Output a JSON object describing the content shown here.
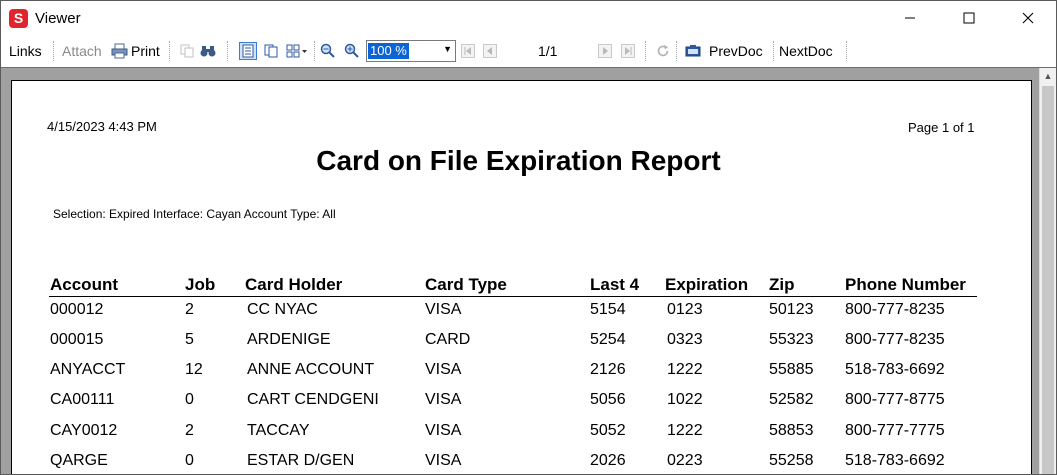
{
  "window": {
    "title": "Viewer",
    "app_icon_letter": "S"
  },
  "toolbar": {
    "links_label": "Links",
    "attach_label": "Attach",
    "print_label": "Print",
    "zoom_value": "100 %",
    "page_indicator": "1/1",
    "prevdoc_label": "PrevDoc",
    "nextdoc_label": "NextDoc"
  },
  "report": {
    "printed_at": "4/15/2023 4:43 PM",
    "page_number": "Page 1 of 1",
    "title": "Card on File Expiration Report",
    "selection": "Selection: Expired Interface: Cayan  Account Type: All",
    "columns": [
      "Account",
      "Job",
      "Card Holder",
      "Card Type",
      "Last 4",
      "Expiration",
      "Zip",
      "Phone Number"
    ],
    "rows": [
      [
        "000012",
        "2",
        "CC NYAC",
        "VISA",
        "5154",
        "0123",
        "50123",
        "800-777-8235"
      ],
      [
        "000015",
        "5",
        "ARDENIGE",
        "CARD",
        "5254",
        "0323",
        "55323",
        "800-777-8235"
      ],
      [
        "ANYACCT",
        "12",
        "ANNE ACCOUNT",
        "VISA",
        "2126",
        "1222",
        "55885",
        "518-783-6692"
      ],
      [
        "CA00111",
        "0",
        "CART CENDGENI",
        "VISA",
        "5056",
        "1022",
        "52582",
        "800-777-8775"
      ],
      [
        "CAY0012",
        "2",
        "TACCAY",
        "VISA",
        "5052",
        "1222",
        "58853",
        "800-777-7775"
      ],
      [
        "QARGE",
        "0",
        "ESTAR D/GEN",
        "VISA",
        "2026",
        "0223",
        "55258",
        "518-783-6692"
      ]
    ]
  }
}
